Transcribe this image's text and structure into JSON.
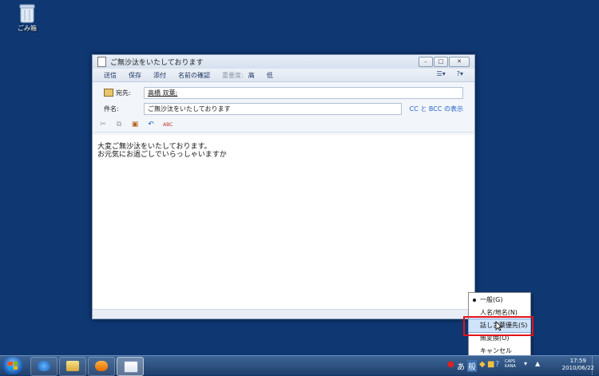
{
  "desktop": {
    "recycle_bin_label": "ごみ箱"
  },
  "window": {
    "title": "ご無沙汰をいたしております",
    "controls": {
      "minimize": "–",
      "maximize": "□",
      "close": "✕"
    },
    "toolbar": {
      "send": "送信",
      "save": "保存",
      "attach": "添付",
      "check_names": "名前の確認",
      "priority": "重要度:",
      "high": "高",
      "low": "低",
      "help": "?"
    },
    "to_label": "宛先:",
    "to_value": "高橋 双葉;",
    "subject_label": "件名:",
    "subject_value": "ご無沙汰をいたしております",
    "cc_bcc_link": "CC と BCC の表示",
    "format_icons": {
      "cut": "✂",
      "copy": "⧉",
      "paste": "▣",
      "undo": "↶",
      "spell": "ABC"
    },
    "body_lines": [
      "大変ご無沙汰をいたしております。",
      "お元気にお過ごしでいらっしゃいますか"
    ]
  },
  "context_menu": {
    "items": [
      {
        "label": "一般(G)",
        "checked": true
      },
      {
        "label": "人名/地名(N)"
      },
      {
        "label": "話し言葉優先(S)",
        "highlighted": true
      },
      {
        "label": "無変換(O)"
      },
      {
        "label": "キャンセル"
      }
    ]
  },
  "taskbar": {
    "tray_ime_mode": "あ",
    "tray_ime_conv": "般",
    "clock_time": "17:59",
    "clock_date": "2010/06/22",
    "caps_text": "CAPS",
    "kana_text": "KANA"
  },
  "colors": {
    "desktop": "#0f3771",
    "highlight_box": "#e0141b",
    "menu_highlight": "#cfe3fb"
  }
}
